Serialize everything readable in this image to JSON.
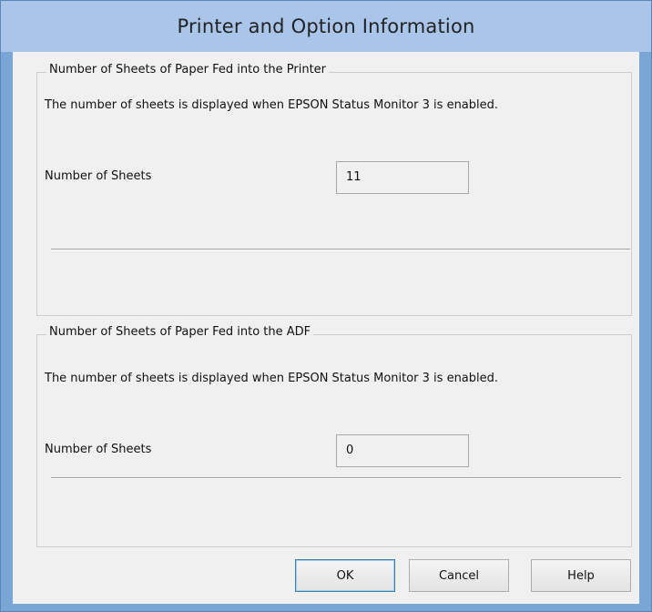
{
  "window": {
    "title": "Printer and Option Information"
  },
  "printer_group": {
    "legend": "Number of Sheets of Paper Fed into the Printer",
    "description": "The number of sheets is displayed when EPSON Status Monitor 3 is enabled.",
    "sheets_label": "Number of Sheets",
    "sheets_value": "11"
  },
  "adf_group": {
    "legend": "Number of Sheets of Paper Fed into the ADF",
    "description": "The number of sheets is displayed when EPSON Status Monitor 3 is enabled.",
    "sheets_label": "Number of Sheets",
    "sheets_value": "0"
  },
  "buttons": {
    "ok": "OK",
    "cancel": "Cancel",
    "help": "Help"
  }
}
